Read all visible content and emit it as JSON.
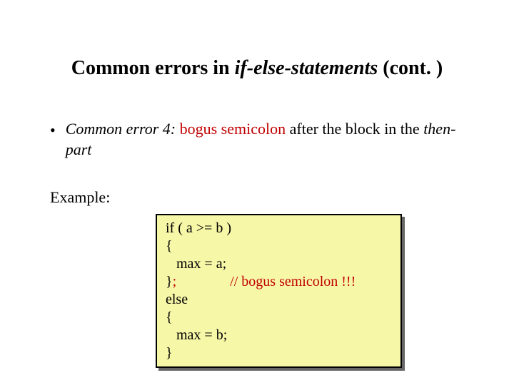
{
  "title": {
    "pre": "Common errors in ",
    "italic": "if-else-statements",
    "post": " (cont. )"
  },
  "bullet": {
    "dot": "•",
    "lead_in": "Common error 4:",
    "space1": " ",
    "red": "bogus semicolon",
    "space2": " after the ",
    "block_word": "block",
    "mid": " in the ",
    "trail": "then-part"
  },
  "example_label": "Example:",
  "code": {
    "l1": "if ( a >= b )",
    "l2": "{",
    "l3": "   max = a;",
    "l4_a": "}",
    "l4_semicolon": ";",
    "l4_gap": "               ",
    "l4_comment": "// bogus semicolon !!!",
    "l5": "else",
    "l6": "{",
    "l7": "   max = b;",
    "l8": "}"
  }
}
